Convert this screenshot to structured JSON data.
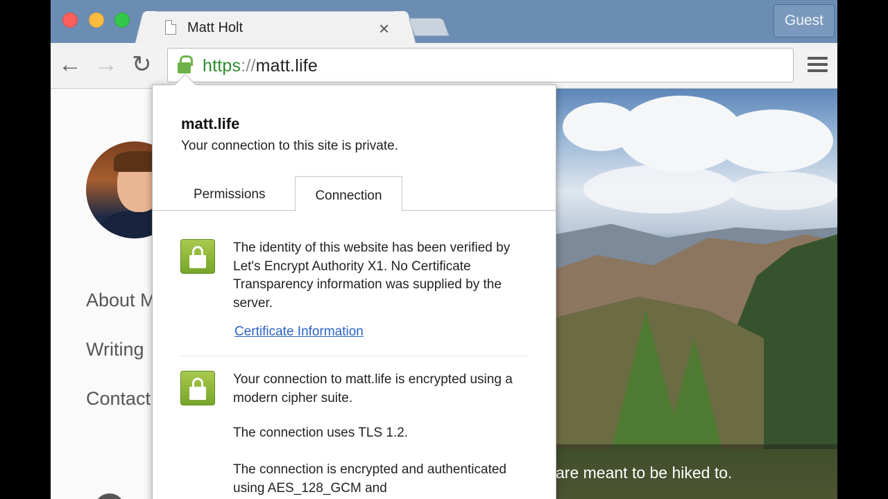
{
  "browser": {
    "tab_title": "Matt Holt",
    "profile_label": "Guest",
    "url_scheme": "https",
    "url_separator": "://",
    "url_host": "matt.life",
    "back_icon": "←",
    "forward_icon": "→",
    "reload_icon": "↻",
    "close_icon": "×"
  },
  "page": {
    "nav": [
      "About M",
      "Writing",
      "Contact"
    ],
    "hero_caption": "are meant to be hiked to."
  },
  "popup": {
    "domain": "matt.life",
    "subtitle": "Your connection to this site is private.",
    "tabs": [
      "Permissions",
      "Connection"
    ],
    "active_tab": "Connection",
    "identity_text": "The identity of this website has been verified by Let's Encrypt Authority X1. No Certificate Transparency information was supplied by the server.",
    "certificate_link": "Certificate Information",
    "encryption_text": "Your connection to matt.life is encrypted using a modern cipher suite.",
    "tls_text": "The connection uses TLS 1.2.",
    "cipher_text": "The connection is encrypted and authenticated using AES_128_GCM and"
  },
  "colors": {
    "secure_green": "#2e8b2e",
    "link_blue": "#2a62c9",
    "tabstrip_blue": "#6b8db3"
  }
}
